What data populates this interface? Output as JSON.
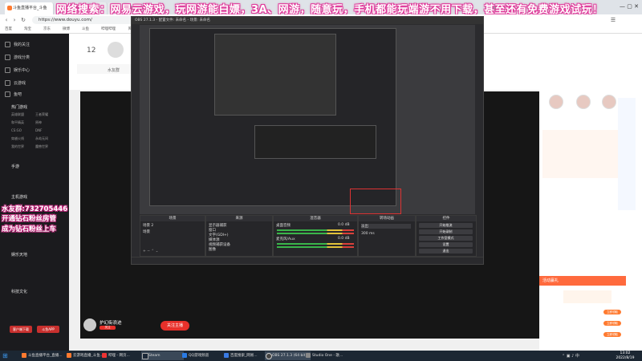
{
  "browser": {
    "active_tab_label": "斗鱼直播平台_斗鱼",
    "url": "https://www.douyu.com/",
    "bookmarks": [
      "百度",
      "淘宝",
      "京东",
      "微博",
      "斗鱼",
      "哔哩哔哩",
      "网易",
      "知乎",
      "爱奇艺",
      "腾讯视频"
    ]
  },
  "banner": {
    "text": "网络搜索：网易云游戏，玩网游能白嫖，3A、网游，随意玩，手机都能玩端游不用下载，甚至还有免费游戏试玩！"
  },
  "sidebar": {
    "items": [
      "我的关注",
      "游戏分类",
      "娱乐中心",
      "云游戏",
      "鱼吧"
    ],
    "sections": [
      "热门游戏",
      "手游",
      "主机游戏",
      "娱乐天地",
      "科技文化"
    ],
    "grid_labels": [
      "英雄联盟",
      "王者荣耀",
      "和平精英",
      "原神",
      "CS:GO",
      "DNF",
      "穿越火线",
      "永劫无间",
      "我的世界",
      "魔兽世界"
    ],
    "button_left": "客户端下载",
    "button_right": "斗鱼APP"
  },
  "page_header": {
    "room_number": "12",
    "streamer_label": "水友群"
  },
  "overlay": {
    "line1": "水友群:732705446",
    "line2": "开通钻石粉丝房管",
    "line3": "成为钻石粉丝上车"
  },
  "obs": {
    "title": "OBS 27.1.3 - 配置文件: 未命名 - 场景: 未命名",
    "docks": {
      "scenes": {
        "header": "场景",
        "items": [
          "场景 2",
          "场景"
        ]
      },
      "sources": {
        "header": "来源",
        "items": [
          "显示器捕获",
          "窗口",
          "文字(GDI+)",
          "媒体源",
          "视频捕获设备",
          "图像"
        ]
      },
      "mixer": {
        "header": "混音器",
        "tracks": [
          {
            "name": "桌面音频",
            "db": "0.0 dB"
          },
          {
            "name": "麦克风/Aux",
            "db": "0.0 dB"
          }
        ]
      },
      "transitions": {
        "header": "转场动画",
        "fade": "淡出",
        "duration": "300 ms"
      },
      "controls": {
        "header": "控件",
        "buttons": [
          "开始推流",
          "开始录制",
          "工作室模式",
          "设置",
          "退出"
        ]
      }
    }
  },
  "host_card": {
    "name": "护幻街浪迹",
    "follow": "关注",
    "follow_label": "关注主播"
  },
  "gift_panel": {
    "title": "活动赢礼",
    "button": "立即领取"
  },
  "taskbar": {
    "items": [
      "斗鱼直播平台_直播...",
      "云游戏直播_斗鱼...",
      "哔哩 - 网页...",
      "Steam",
      "QQ游戏频道",
      "百度搜索_网易...",
      "OBS 27.1.3 (64 bit)",
      "Studio One - 歌..."
    ],
    "time": "13:02",
    "date": "2022/8/19"
  }
}
